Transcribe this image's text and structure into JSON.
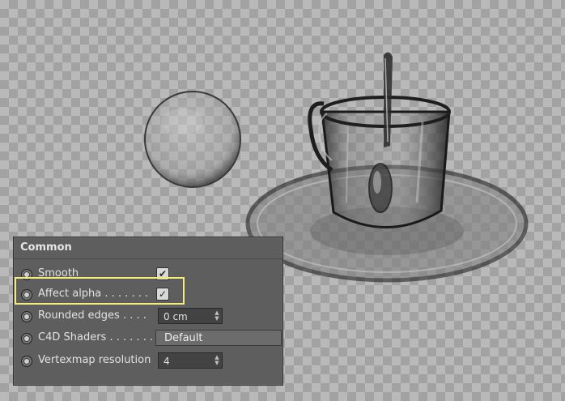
{
  "panel": {
    "title": "Common",
    "rows": [
      {
        "label": "Smooth",
        "type": "checkbox",
        "checked": true,
        "check_glyph": "✔"
      },
      {
        "label": "Affect alpha . . . . . . .",
        "type": "checkbox",
        "checked": true,
        "check_glyph": "✓"
      },
      {
        "label": "Rounded edges . . . .",
        "type": "number",
        "value": "0 cm"
      },
      {
        "label": "C4D Shaders . . . . . . . .",
        "type": "dropdown",
        "value": "Default"
      },
      {
        "label": "Vertexmap resolution",
        "type": "number",
        "value": "4"
      }
    ]
  },
  "icons": {
    "radio": "radio-dot-icon",
    "stepper": "stepper-arrows-icon"
  },
  "colors": {
    "highlight": "#f2ec7a",
    "panel_bg": "#5e5e5e",
    "checker_light": "#b9b9b9",
    "checker_dark": "#a2a2a2"
  },
  "scene": {
    "objects": [
      "glass-sphere",
      "glass-cup",
      "spoon",
      "saucer"
    ]
  }
}
